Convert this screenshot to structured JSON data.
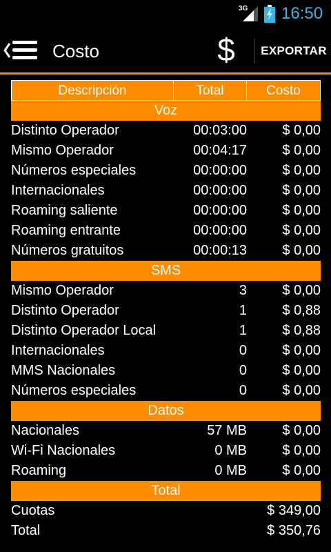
{
  "status_bar": {
    "network": "3G",
    "time": "16:50"
  },
  "action_bar": {
    "title": "Costo",
    "dollar_icon": "$",
    "export_label": "EXPORTAR"
  },
  "table": {
    "headers": [
      "Descripción",
      "Total",
      "Costo"
    ],
    "sections": [
      {
        "title": "Voz",
        "rows": [
          {
            "desc": "Distinto Operador",
            "total": "00:03:00",
            "cost": "$ 0,00"
          },
          {
            "desc": "Mismo Operador",
            "total": "00:04:17",
            "cost": "$ 0,00"
          },
          {
            "desc": "Números especiales",
            "total": "00:00:00",
            "cost": "$ 0,00"
          },
          {
            "desc": "Internacionales",
            "total": "00:00:00",
            "cost": "$ 0,00"
          },
          {
            "desc": "Roaming saliente",
            "total": "00:00:00",
            "cost": "$ 0,00"
          },
          {
            "desc": "Roaming entrante",
            "total": "00:00:00",
            "cost": "$ 0,00"
          },
          {
            "desc": "Números gratuitos",
            "total": "00:00:13",
            "cost": "$ 0,00"
          }
        ]
      },
      {
        "title": "SMS",
        "rows": [
          {
            "desc": "Mismo Operador",
            "total": "3",
            "cost": "$ 0,00"
          },
          {
            "desc": "Distinto Operador",
            "total": "1",
            "cost": "$ 0,88"
          },
          {
            "desc": "Distinto Operador Local",
            "total": "1",
            "cost": "$ 0,88"
          },
          {
            "desc": "Internacionales",
            "total": "0",
            "cost": "$ 0,00"
          },
          {
            "desc": "MMS Nacionales",
            "total": "0",
            "cost": "$ 0,00"
          },
          {
            "desc": "Números especiales",
            "total": "0",
            "cost": "$ 0,00"
          }
        ]
      },
      {
        "title": "Datos",
        "rows": [
          {
            "desc": "Nacionales",
            "total": "57 MB",
            "cost": "$ 0,00"
          },
          {
            "desc": "Wi-Fi Nacionales",
            "total": "0 MB",
            "cost": "$ 0,00"
          },
          {
            "desc": "Roaming",
            "total": "0 MB",
            "cost": "$ 0,00"
          }
        ]
      }
    ],
    "total_section": {
      "title": "Total",
      "rows": [
        {
          "label": "Cuotas",
          "cost": "$ 349,00"
        },
        {
          "label": "Total",
          "cost": "$ 350,76"
        }
      ]
    }
  },
  "colors": {
    "accent": "#ff8c00",
    "clock": "#33b5e5",
    "background": "#000000",
    "text": "#ffffff"
  }
}
